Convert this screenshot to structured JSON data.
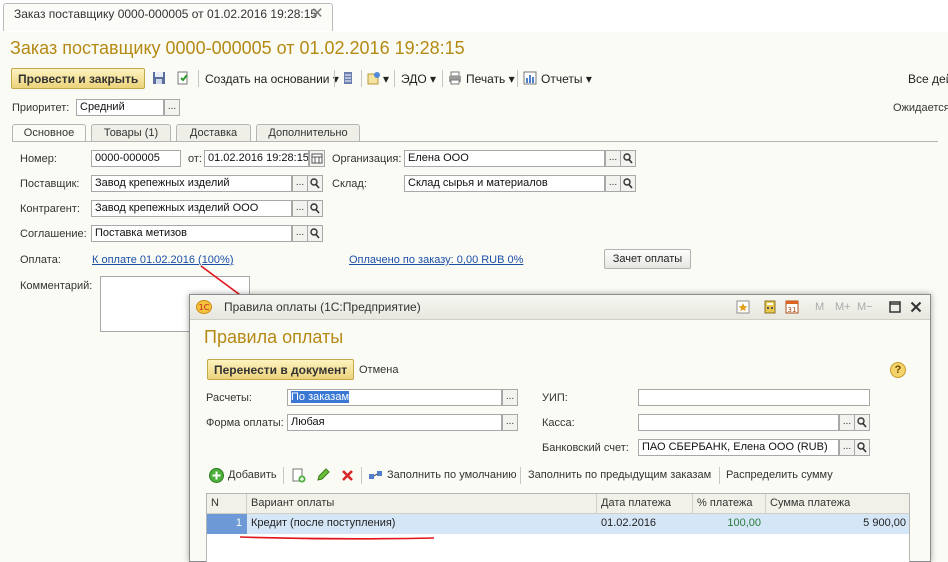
{
  "tab": {
    "title": "Заказ поставщику 0000-000005 от 01.02.2016 19:28:15",
    "close": "✕"
  },
  "header": {
    "title": "Заказ поставщику 0000-000005 от 01.02.2016 19:28:15"
  },
  "toolbar": {
    "post_close": "Провести и закрыть",
    "create_based": "Создать на основании",
    "edo": "ЭДО",
    "print": "Печать",
    "reports": "Отчеты",
    "all_actions": "Все дей"
  },
  "priority": {
    "label": "Приоритет:",
    "value": "Средний",
    "status": "Ожидается"
  },
  "tabs": [
    "Основное",
    "Товары (1)",
    "Доставка",
    "Дополнительно"
  ],
  "form": {
    "number_label": "Номер:",
    "number": "0000-000005",
    "date_label": "от:",
    "date": "01.02.2016 19:28:15",
    "org_label": "Организация:",
    "org": "Елена ООО",
    "supplier_label": "Поставщик:",
    "supplier": "Завод крепежных изделий",
    "warehouse_label": "Склад:",
    "warehouse": "Склад сырья и материалов",
    "counterparty_label": "Контрагент:",
    "counterparty": "Завод крепежных изделий ООО",
    "agreement_label": "Соглашение:",
    "agreement": "Поставка метизов",
    "payment_label": "Оплата:",
    "payment_link": "К оплате 01.02.2016 (100%)",
    "paid_link": "Оплачено по заказу: 0,00 RUB  0%",
    "offset_button": "Зачет оплаты",
    "comment_label": "Комментарий:",
    "ellipsis": "..."
  },
  "dialog": {
    "window_title": "Правила оплаты  (1С:Предприятие)",
    "heading": "Правила оплаты",
    "transfer_button": "Перенести в документ",
    "cancel": "Отмена",
    "help": "?",
    "window_controls": [
      "M",
      "M+",
      "M−"
    ],
    "calc_label": "Расчеты:",
    "calc_value": "По заказам",
    "form_label": "Форма оплаты:",
    "form_value": "Любая",
    "uip_label": "УИП:",
    "uip_value": "",
    "cash_label": "Касса:",
    "cash_value": "",
    "bank_label": "Банковский счет:",
    "bank_value": "ПАО СБЕРБАНК, Елена ООО (RUB)",
    "toolbar": {
      "add": "Добавить",
      "fill_default": "Заполнить по умолчанию",
      "fill_previous": "Заполнить по предыдущим заказам",
      "distribute": "Распределить сумму"
    },
    "table": {
      "columns": [
        "N",
        "Вариант оплаты",
        "Дата платежа",
        "% платежа",
        "Сумма платежа"
      ],
      "rows": [
        {
          "n": "1",
          "variant": "Кредит (после поступления)",
          "date": "01.02.2016",
          "percent": "100,00",
          "sum": "5 900,00"
        }
      ]
    }
  },
  "colors": {
    "accent": "#b58a14",
    "link": "#1a4fa8",
    "annotation": "#e0141a",
    "selected_row": "#d5e6f7"
  }
}
